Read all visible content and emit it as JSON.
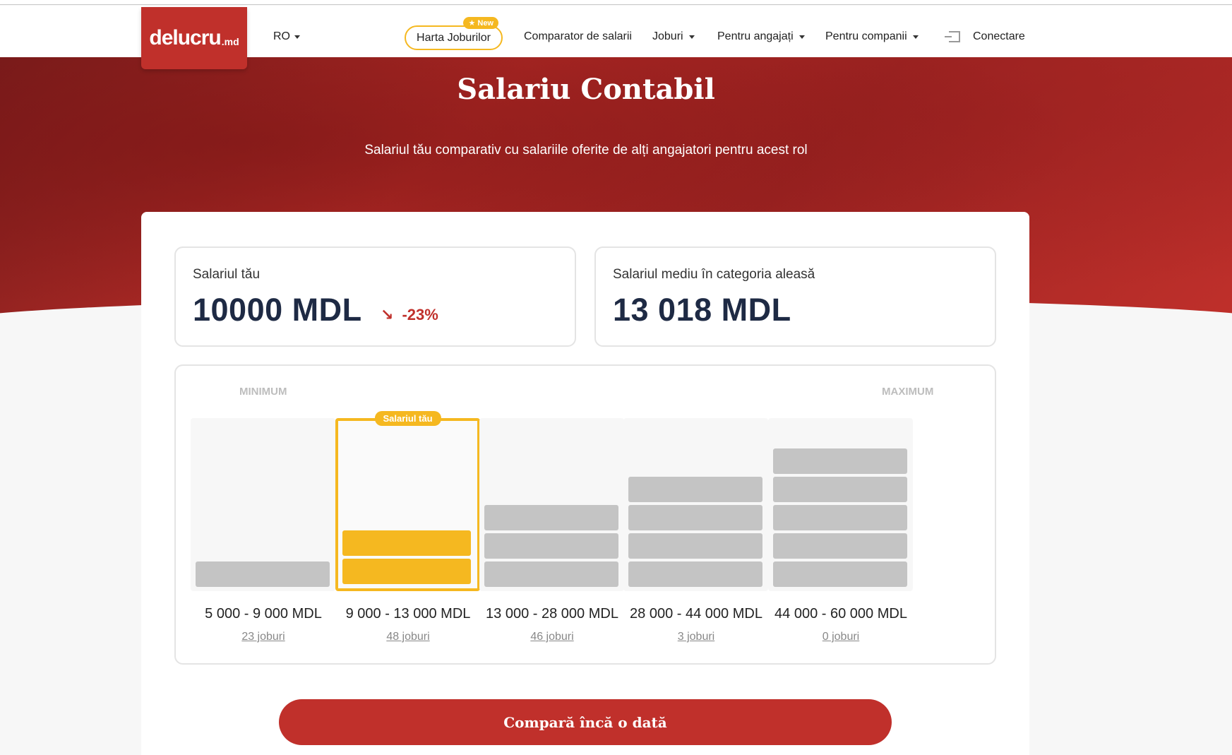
{
  "nav": {
    "logo_main": "delucru",
    "logo_suffix": ".md",
    "lang": "RO",
    "harta": "Harta Joburilor",
    "new_badge": "New",
    "comparator": "Comparator de salarii",
    "joburi": "Joburi",
    "angajati": "Pentru angajați",
    "companii": "Pentru companii",
    "login": "Conectare"
  },
  "hero": {
    "title": "Salariu Contabil",
    "subtitle": "Salariul tău comparativ cu salariile oferite de alți angajatori pentru acest rol"
  },
  "stats": {
    "yours_label": "Salariul tău",
    "yours_value": "10000 MDL",
    "diff_arrow": "↘",
    "diff": "-23%",
    "avg_label": "Salariul mediu în categoria aleasă",
    "avg_value": "13 018 MDL"
  },
  "chart_data": {
    "type": "bar",
    "min_label": "MINIMUM",
    "max_label": "MAXIMUM",
    "your_tag": "Salariul tău",
    "categories": [
      "5 000 - 9 000 MDL",
      "9 000 - 13 000 MDL",
      "13 000 - 28 000 MDL",
      "28 000 - 44 000 MDL",
      "44 000 - 60 000 MDL"
    ],
    "jobs": [
      "23 joburi",
      "48 joburi",
      "46 joburi",
      "3 joburi",
      "0 joburi"
    ],
    "blocks": [
      1,
      2,
      3,
      4,
      5
    ],
    "active_index": 1
  },
  "cta": "Compară încă o dată",
  "colors": {
    "brand": "#c0302b",
    "accent": "#f5b820",
    "bar": "#c4c4c4"
  }
}
